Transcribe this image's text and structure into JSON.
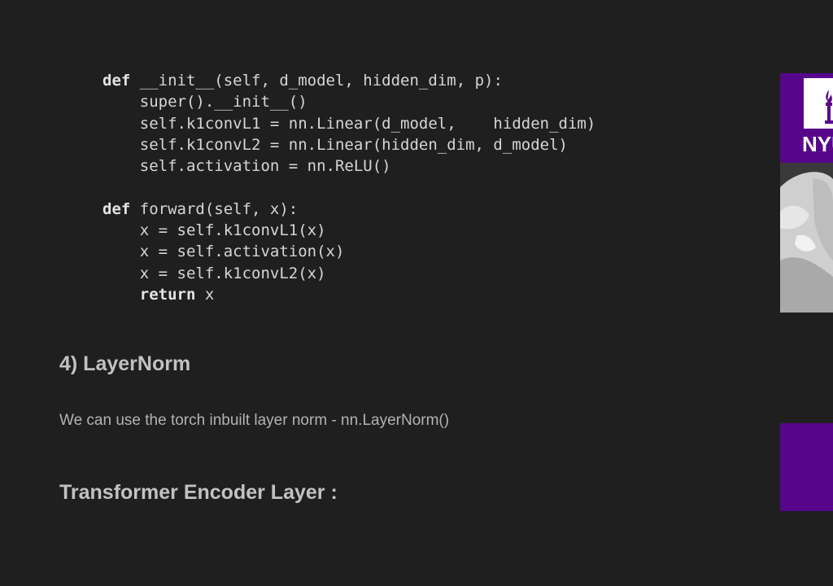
{
  "code": {
    "lines": [
      {
        "kw": "def",
        "rest": " __init__(self, d_model, hidden_dim, p):"
      },
      {
        "kw": "",
        "rest": "    super().__init__()"
      },
      {
        "kw": "",
        "rest": "    self.k1convL1 = nn.Linear(d_model,    hidden_dim)"
      },
      {
        "kw": "",
        "rest": "    self.k1convL2 = nn.Linear(hidden_dim, d_model)"
      },
      {
        "kw": "",
        "rest": "    self.activation = nn.ReLU()"
      },
      {
        "kw": "",
        "rest": ""
      },
      {
        "kw": "def",
        "rest": " forward(self, x):"
      },
      {
        "kw": "",
        "rest": "    x = self.k1convL1(x)"
      },
      {
        "kw": "",
        "rest": "    x = self.activation(x)"
      },
      {
        "kw": "",
        "rest": "    x = self.k1convL2(x)"
      },
      {
        "kw": "return",
        "rest": " x",
        "indent": "    "
      }
    ]
  },
  "section_layernorm": {
    "heading": "4) LayerNorm",
    "text": "We can use the torch inbuilt layer norm - nn.LayerNorm()"
  },
  "section_encoder": {
    "heading": "Transformer Encoder Layer :"
  },
  "overlay": {
    "logo_text": "NYU",
    "brand_color": "#57068c"
  }
}
